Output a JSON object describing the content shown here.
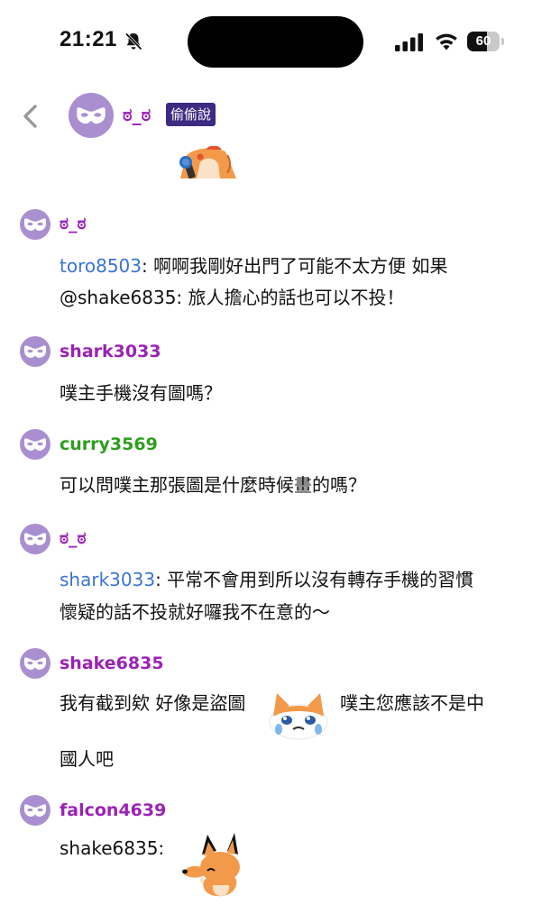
{
  "status_bar": {
    "time": "21:21",
    "battery_percent": "60",
    "battery_level": 0.6
  },
  "header": {
    "user_name": "ಠ_ಠ",
    "badge_label": "偷偷說"
  },
  "colors": {
    "username_purple": "#9b22b6",
    "username_green": "#2e9e1e",
    "mention_blue": "#3b74d3",
    "avatar_lilac": "#a98fd0",
    "badge_bg": "#3c2a83"
  },
  "messages": [
    {
      "user": "ಠ_ಠ",
      "line1_mention": "toro8503",
      "line1_text": ": 啊啊我剛好出門了可能不太方便 如果",
      "line2_text": "@shake6835: 旅人擔心的話也可以不投！"
    },
    {
      "user": "shark3033",
      "text": "噗主手機沒有圖嗎？"
    },
    {
      "user": "curry3569",
      "text": "可以問噗主那張圖是什麼時候畫的嗎？"
    },
    {
      "user": "ಠ_ಠ",
      "line1_mention": "shark3033",
      "line1_text": ": 平常不會用到所以沒有轉存手機的習慣",
      "line2_text": "懷疑的話不投就好囉我不在意的～"
    },
    {
      "user": "shake6835",
      "text_before_sticker": "我有截到欸 好像是盜圖",
      "text_after_sticker": "噗主您應該不是中",
      "line2_text": "國人吧"
    },
    {
      "user": "falcon4639",
      "text": "shake6835:"
    }
  ]
}
